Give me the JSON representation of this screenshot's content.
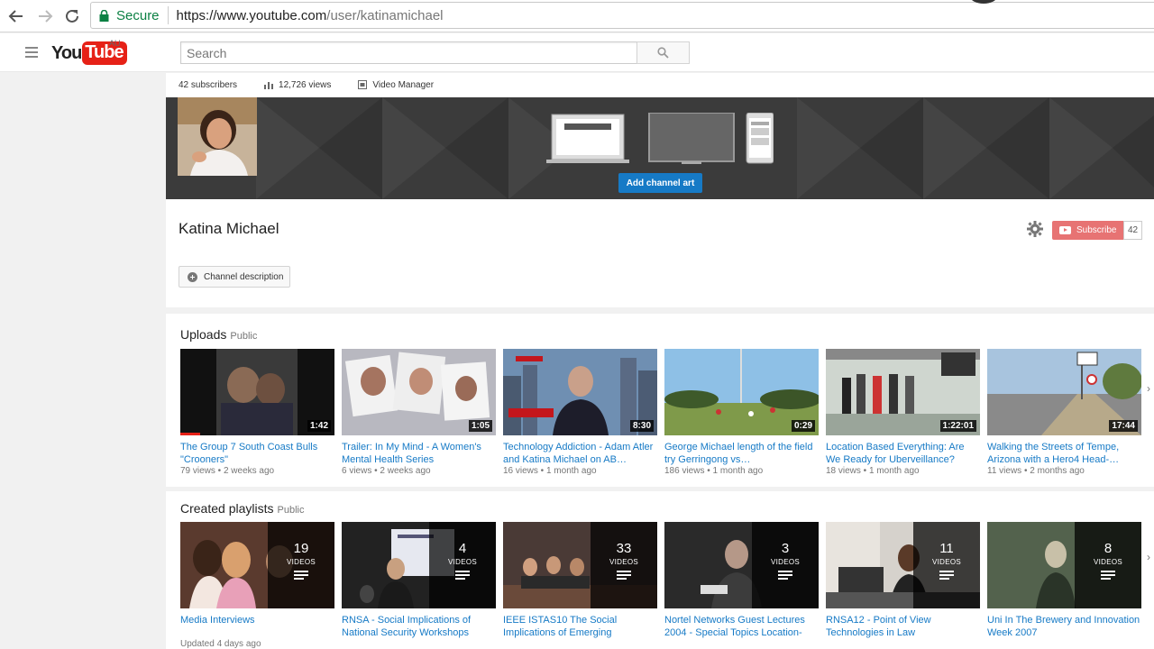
{
  "browser": {
    "secure_label": "Secure",
    "url_host": "https://www.youtube.com",
    "url_path": "/user/katinamichael"
  },
  "masthead": {
    "logo_you": "You",
    "logo_tube": "Tube",
    "logo_country": "AU",
    "search_placeholder": "Search"
  },
  "channel": {
    "subscribers": "42 subscribers",
    "views": "12,726 views",
    "video_manager": "Video Manager",
    "add_art": "Add channel art",
    "name": "Katina Michael",
    "subscribe_label": "Subscribe",
    "subscriber_count": "42",
    "description_btn": "Channel description"
  },
  "uploads": {
    "heading": "Uploads",
    "visibility": "Public",
    "videos": [
      {
        "title": "The Group 7 South Coast Bulls \"Crooners\"",
        "duration": "1:42",
        "views": "79 views",
        "age": "2 weeks ago"
      },
      {
        "title": "Trailer: In My Mind - A Women's Mental Health Series",
        "duration": "1:05",
        "views": "6 views",
        "age": "2 weeks ago"
      },
      {
        "title": "Technology Addiction - Adam Atler and Katina Michael on AB…",
        "duration": "8:30",
        "views": "16 views",
        "age": "1 month ago"
      },
      {
        "title": "George Michael length of the field try Gerringong vs…",
        "duration": "0:29",
        "views": "186 views",
        "age": "1 month ago"
      },
      {
        "title": "Location Based Everything: Are We Ready for Uberveillance?",
        "duration": "1:22:01",
        "views": "18 views",
        "age": "1 month ago"
      },
      {
        "title": "Walking the Streets of Tempe, Arizona with a Hero4 Head-…",
        "duration": "17:44",
        "views": "11 views",
        "age": "2 months ago"
      }
    ]
  },
  "playlists": {
    "heading": "Created playlists",
    "visibility": "Public",
    "videos_label": "VIDEOS",
    "items": [
      {
        "title": "Media Interviews",
        "count": "19",
        "meta": "Updated 4 days ago"
      },
      {
        "title": "RNSA - Social Implications of National Security Workshops",
        "count": "4",
        "meta": ""
      },
      {
        "title": "IEEE ISTAS10 The Social Implications of Emerging",
        "count": "33",
        "meta": ""
      },
      {
        "title": "Nortel Networks Guest Lectures 2004 - Special Topics Location-",
        "count": "3",
        "meta": ""
      },
      {
        "title": "RNSA12 - Point of View Technologies in Law",
        "count": "11",
        "meta": ""
      },
      {
        "title": "Uni In The Brewery and Innovation Week 2007",
        "count": "8",
        "meta": ""
      }
    ]
  },
  "colors": {
    "accent_blue": "#167ac6",
    "youtube_red": "#e62117",
    "subscribe_disabled": "#e77373",
    "secure_green": "#0b8043"
  }
}
